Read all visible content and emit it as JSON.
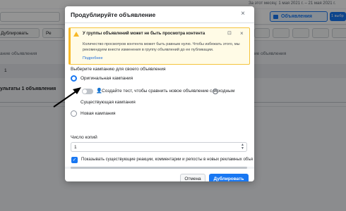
{
  "background": {
    "date_range": "За этот месяц: 1 мая 2021 г. – 21 мая 2021 г.",
    "ads_tab": "Объявления",
    "ads_count": "1 выбр",
    "toolbar_duplicate": "Дублировать",
    "toolbar_edit_short": "Ре",
    "column_header_left": "ание объявления",
    "column_header_right": "ие объявления",
    "row_value": "1",
    "results_label": "ультаты 1 объявления"
  },
  "modal": {
    "title": "Продублируйте объявление",
    "close_glyph": "×",
    "warning": {
      "title": "У группы объявлений может не быть просмотра контента",
      "text": "Количество просмотров контента может быть равным нулю. Чтобы избежать этого, мы рекомендуем внести изменения в группу объявлений до ее публикации.",
      "link": "Подробнее",
      "pin_glyph": "⊡",
      "close_glyph": "×"
    },
    "campaign_section_label": "Выберите кампанию для своего объявления",
    "options": {
      "original": "Оригинальная кампания",
      "test_toggle": "Создайте тест, чтобы сравнить новое объявление с исходным",
      "existing": "Существующая кампания",
      "new": "Новая кампания"
    },
    "copies_label": "Число копий",
    "copies_value": "1",
    "checkbox_label": "Показывать существующие реакции, комментарии и репосты в новых рекламных объя",
    "cancel_button": "Отмена",
    "duplicate_button": "Дублировать"
  }
}
